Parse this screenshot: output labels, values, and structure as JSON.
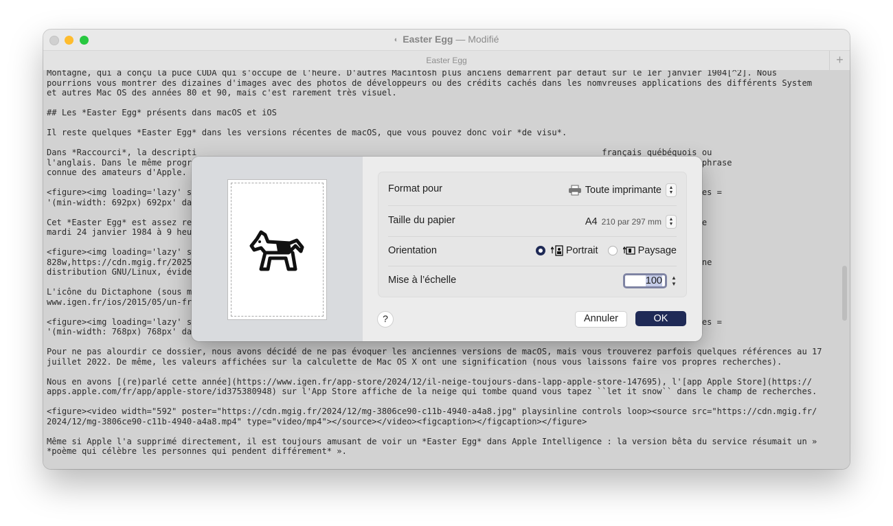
{
  "window": {
    "title": "Easter Egg",
    "title_separator": " — ",
    "title_status": "Modifié",
    "tab_title": "Easter Egg",
    "tab_add": "+"
  },
  "editor": {
    "lines": [
      "Montagne, qui a conçu la puce CUDA qui s'occupe de l'heure. D'autres Macintosh plus anciens démarrent par défaut sur le 1er janvier 1904[^2]. Nous",
      "pourrions vous montrer des dizaines d'images avec des photos de développeurs ou des crédits cachés dans les nomvreuses applications des différents System",
      "et autres Mac OS des années 80 et 90, mais c'est rarement très visuel.",
      "",
      "## Les *Easter Egg* présents dans macOS et iOS",
      "",
      "Il reste quelques *Easter Egg* dans les versions récentes de macOS, que vous pouvez donc voir *de visu*.",
      "",
      "Dans *Raccourci*, la descripti                                                                                 français québéquois ou",
      "l'anglais. Dans le même progr                                                                                  un code QR* est une phrase",
      "connue des amateurs d'Apple.",
      "",
      "<figure><img loading='lazy' s                                                                                  9-w692.jpg 692w' sizes =",
      "'(min-width: 692px) 692px' da",
      "",
      "Cet *Easter Egg* est assez re                                                                                  ion du fichier est le",
      "mardi 24 janvier 1984 à 9 heu",
      "",
      "<figure><img loading='lazy' s                                                                                  47caceb-w828.jpg",
      "828w,https://cdn.mgig.fr/2025                                                                                   markdown='1'>Avec une",
      "distribution GNU/Linux, évide",
      "",
      "L'icône du Dictaphone (sous m                                                                                   *Apple*](https://",
      "www.igen.fr/ios/2015/05/un-fr",
      "",
      "<figure><img loading='lazy' s                                                                                  c-w768.jpg 768w' sizes =",
      "'(min-width: 768px) 768px' da                                                                                  n></figure>",
      "",
      "Pour ne pas alourdir ce dossier, nous avons décidé de ne pas évoquer les anciennes versions de macOS, mais vous trouverez parfois quelques références au 17",
      "juillet 2022. De même, les valeurs affichées sur la calculette de Mac OS X ont une signification (nous vous laissons faire vos propres recherches).",
      "",
      "Nous en avons [(re)parlé cette année](https://www.igen.fr/app-store/2024/12/il-neige-toujours-dans-lapp-apple-store-147695), l'[app Apple Store](https://",
      "apps.apple.com/fr/app/apple-store/id375380948) sur l'App Store affiche de la neige qui tombe quand vous tapez ``let it snow`` dans le champ de recherches.",
      "",
      "<figure><video width=\"592\" poster=\"https://cdn.mgig.fr/2024/12/mg-3806ce90-c11b-4940-a4a8.jpg\" playsinline controls loop><source src=\"https://cdn.mgig.fr/",
      "2024/12/mg-3806ce90-c11b-4940-a4a8.mp4\" type=\"video/mp4\"></source></video><figcaption></figcaption></figure>",
      "",
      "Même si Apple l'a supprimé directement, il est toujours amusant de voir un *Easter Egg* dans Apple Intelligence : la version bêta du service résumait un »",
      "*poème qui célèbre les personnes qui pendent différement* »."
    ]
  },
  "print_dialog": {
    "format_label": "Format pour",
    "format_value": "Toute imprimante",
    "paper_label": "Taille du papier",
    "paper_value": "A4",
    "paper_dims": "210 par 297 mm",
    "orientation_label": "Orientation",
    "portrait_label": "Portrait",
    "landscape_label": "Paysage",
    "orientation_selected": "Portrait",
    "scale_label": "Mise à l’échelle",
    "scale_value": "100",
    "help_label": "?",
    "cancel_label": "Annuler",
    "ok_label": "OK"
  },
  "colors": {
    "accent": "#1f2a56",
    "close": "#d0d0d0",
    "minimize": "#febc2e",
    "maximize": "#28c840"
  }
}
